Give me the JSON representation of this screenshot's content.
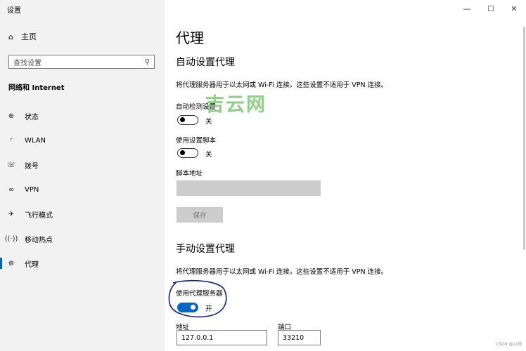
{
  "app_title": "设置",
  "window_controls": {
    "minimize": "—",
    "maximize": "☐",
    "close": "✕"
  },
  "sidebar": {
    "home": "主页",
    "search_placeholder": "查找设置",
    "section_header": "网络和 Internet",
    "items": [
      {
        "label": "状态",
        "icon": "status-icon"
      },
      {
        "label": "WLAN",
        "icon": "wifi-icon"
      },
      {
        "label": "拨号",
        "icon": "dialup-icon"
      },
      {
        "label": "VPN",
        "icon": "vpn-icon"
      },
      {
        "label": "飞行模式",
        "icon": "airplane-icon"
      },
      {
        "label": "移动热点",
        "icon": "hotspot-icon"
      },
      {
        "label": "代理",
        "icon": "globe-icon"
      }
    ],
    "selected": "代理"
  },
  "main": {
    "title": "代理",
    "auto": {
      "heading": "自动设置代理",
      "description": "将代理服务器用于以太网或 Wi-Fi 连接。这些设置不适用于 VPN 连接。",
      "auto_detect_label": "自动检测设置",
      "auto_detect_state": "关",
      "script_label": "使用设置脚本",
      "script_state": "关",
      "script_address_label": "脚本地址",
      "save_label": "保存"
    },
    "manual": {
      "heading": "手动设置代理",
      "description": "将代理服务器用于以太网或 Wi-Fi 连接。这些设置不适用于 VPN 连接。",
      "use_proxy_label": "使用代理服务器",
      "use_proxy_state": "开",
      "address_label": "地址",
      "address_value": "127.0.0.1",
      "port_label": "端口",
      "port_value": "33210"
    }
  },
  "watermark": "吉云网",
  "credit": "CSDN @zz孩",
  "colors": {
    "accent": "#0a66c2",
    "sidebar_bg": "#f2f2f2",
    "annotation": "#0b1f8f"
  }
}
